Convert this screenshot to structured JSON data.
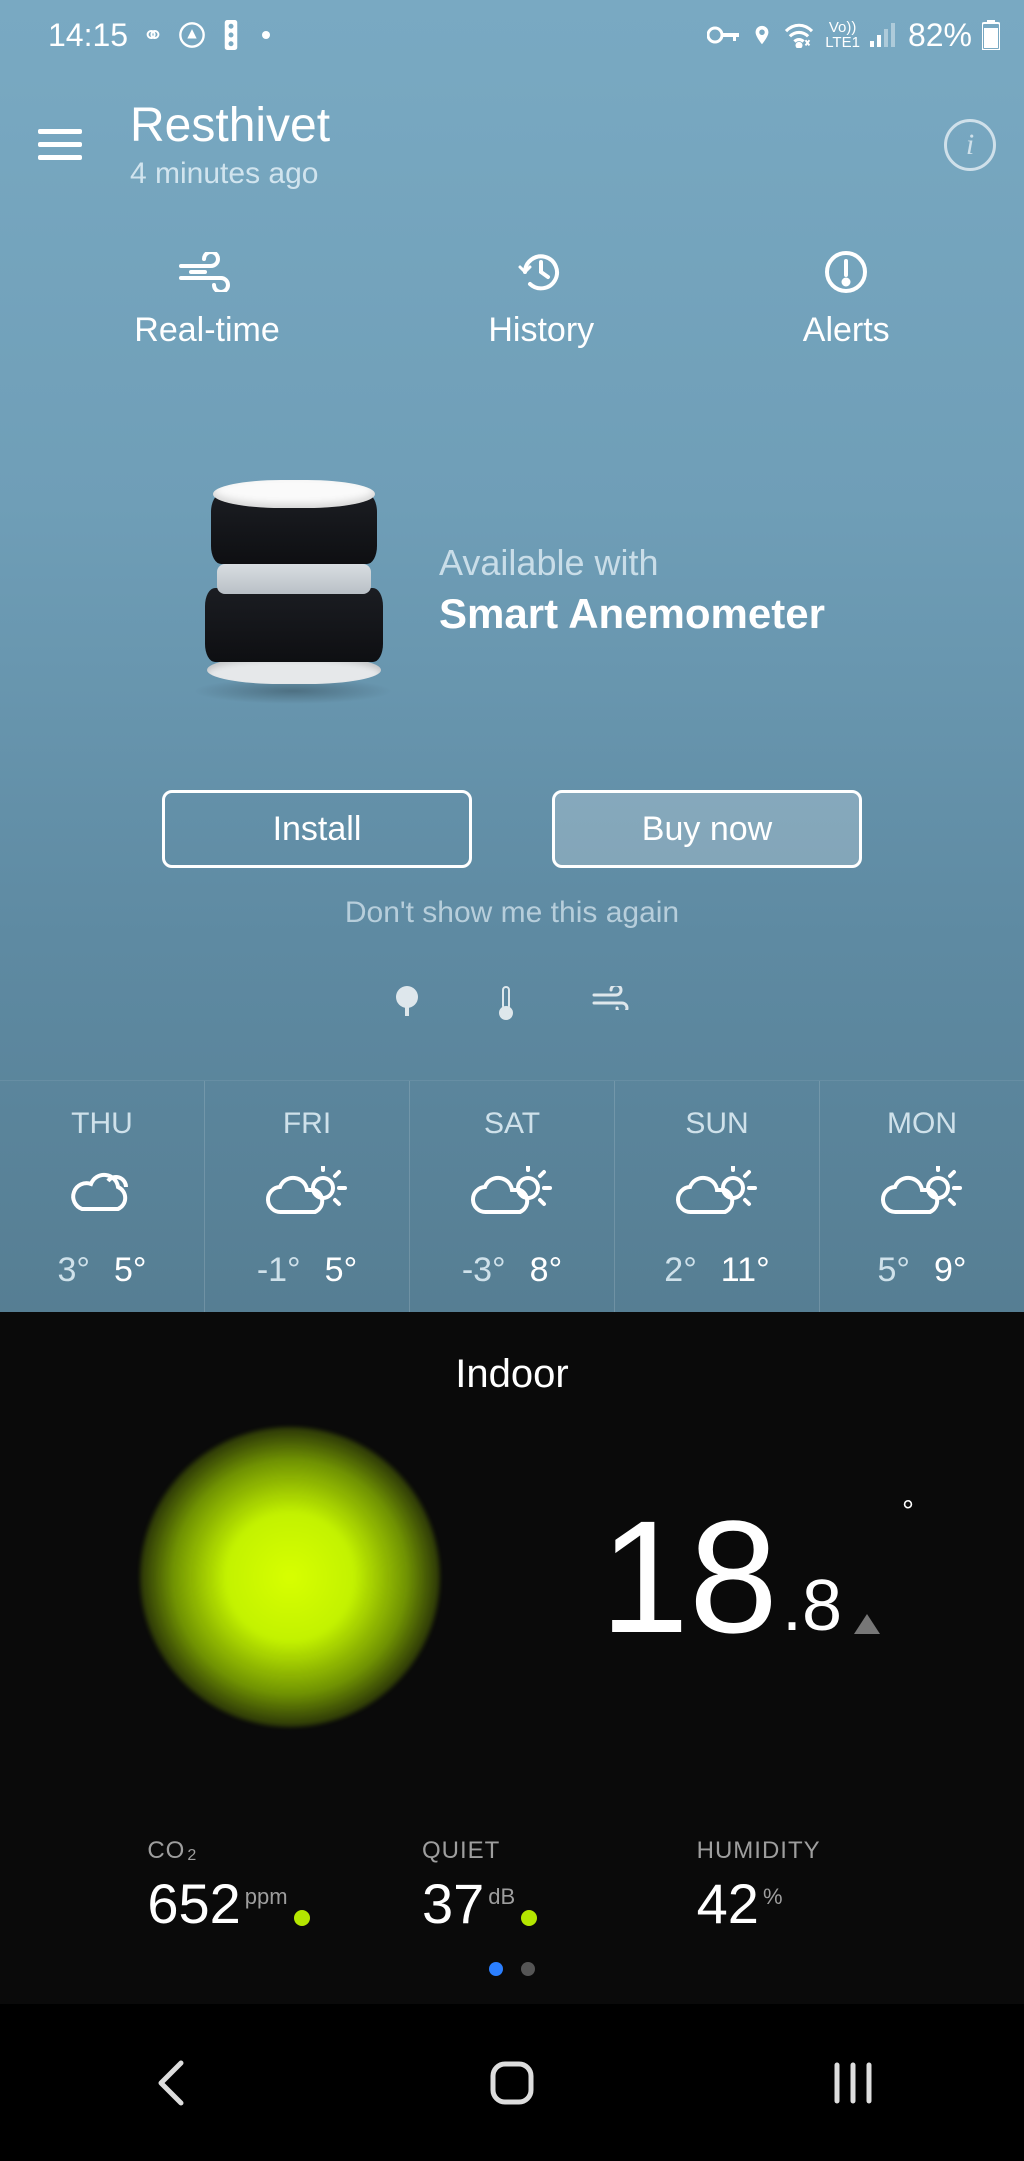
{
  "status": {
    "time": "14:15",
    "battery": "82%",
    "network": "LTE1",
    "vo": "Vo))"
  },
  "header": {
    "title": "Resthivet",
    "subtitle": "4 minutes ago"
  },
  "tabs": [
    {
      "label": "Real-time"
    },
    {
      "label": "History"
    },
    {
      "label": "Alerts"
    }
  ],
  "promo": {
    "line1": "Available with",
    "line2": "Smart Anemometer",
    "install": "Install",
    "buy": "Buy now",
    "dismiss": "Don't show me this again"
  },
  "forecast": [
    {
      "day": "THU",
      "low": "3°",
      "high": "5°",
      "icon": "cloud"
    },
    {
      "day": "FRI",
      "low": "-1°",
      "high": "5°",
      "icon": "partly"
    },
    {
      "day": "SAT",
      "low": "-3°",
      "high": "8°",
      "icon": "partly"
    },
    {
      "day": "SUN",
      "low": "2°",
      "high": "11°",
      "icon": "partly"
    },
    {
      "day": "MON",
      "low": "5°",
      "high": "9°",
      "icon": "partly"
    }
  ],
  "indoor": {
    "title": "Indoor",
    "temp_whole": "18",
    "temp_dec": ".8",
    "deg": "°",
    "co2_label": "CO",
    "co2_sub": "2",
    "co2_value": "652",
    "co2_unit": "ppm",
    "noise_label": "QUIET",
    "noise_value": "37",
    "noise_unit": "dB",
    "hum_label": "HUMIDITY",
    "hum_value": "42",
    "hum_unit": "%"
  }
}
